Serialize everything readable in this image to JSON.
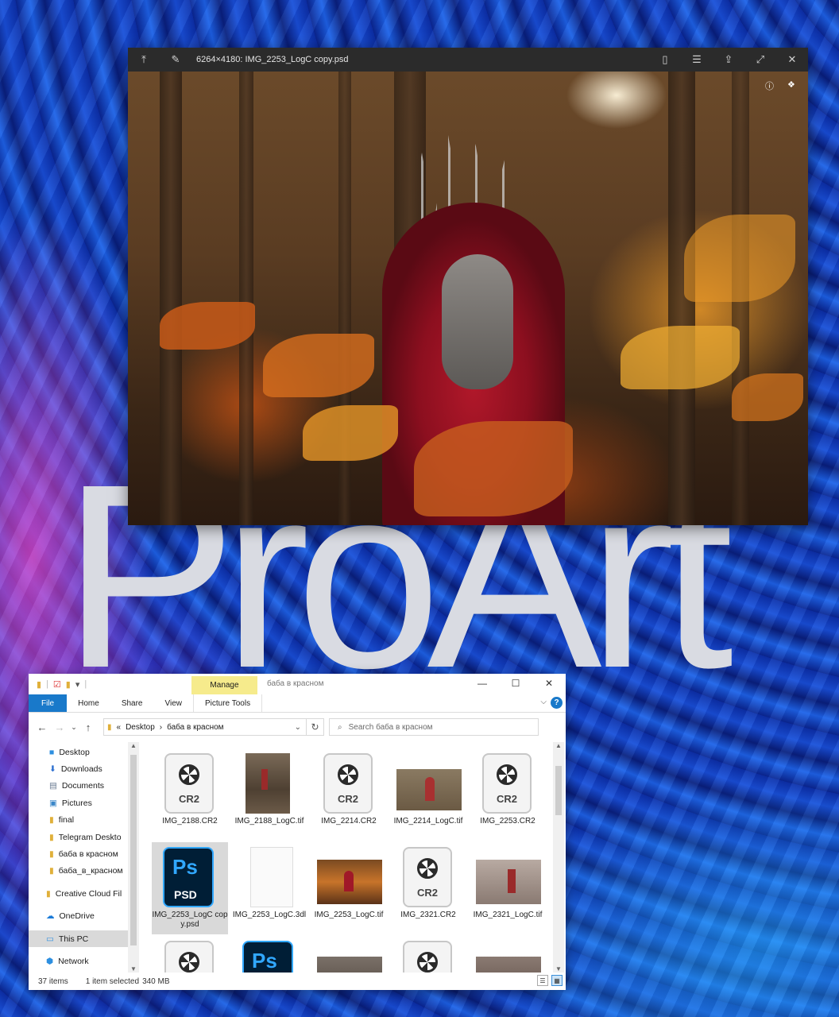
{
  "desktop": {
    "wallpaper_text": "ProArt"
  },
  "viewer": {
    "title": "6264×4180: IMG_2253_LogC copy.psd",
    "icons": [
      "pin-top-icon",
      "pin-icon",
      "file-icon",
      "list-icon",
      "share-icon",
      "fullscreen-icon",
      "close-icon",
      "info-icon",
      "color-icon"
    ]
  },
  "explorer": {
    "title": "баба в красном",
    "manage_tab": "Manage",
    "ribbon_tabs": [
      "File",
      "Home",
      "Share",
      "View",
      "Picture Tools"
    ],
    "breadcrumb": {
      "root": "«",
      "part1": "Desktop",
      "part2": "баба в красном"
    },
    "search_placeholder": "Search баба в красном",
    "nav_items": [
      {
        "label": "Desktop",
        "icon": "desktop-icon",
        "pinned": true
      },
      {
        "label": "Downloads",
        "icon": "download-icon",
        "pinned": true
      },
      {
        "label": "Documents",
        "icon": "documents-icon",
        "pinned": true
      },
      {
        "label": "Pictures",
        "icon": "pictures-icon",
        "pinned": true
      },
      {
        "label": "final",
        "icon": "folder-icon",
        "pinned": false
      },
      {
        "label": "Telegram Deskto",
        "icon": "folder-icon",
        "pinned": false
      },
      {
        "label": "баба в красном",
        "icon": "folder-icon",
        "pinned": false
      },
      {
        "label": "баба_в_красном",
        "icon": "folder-icon",
        "pinned": false
      },
      {
        "label": "Creative Cloud Fil",
        "icon": "creative-cloud-icon",
        "pinned": false
      },
      {
        "label": "OneDrive",
        "icon": "onedrive-icon",
        "pinned": false
      },
      {
        "label": "This PC",
        "icon": "pc-icon",
        "pinned": false
      },
      {
        "label": "Network",
        "icon": "network-icon",
        "pinned": false
      }
    ],
    "files": [
      {
        "name": "IMG_2188.CR2",
        "kind": "cr2",
        "tag": "CR2"
      },
      {
        "name": "IMG_2188_LogC.tif",
        "kind": "photo-tall"
      },
      {
        "name": "IMG_2214.CR2",
        "kind": "cr2",
        "tag": "CR2"
      },
      {
        "name": "IMG_2214_LogC.tif",
        "kind": "photo"
      },
      {
        "name": "IMG_2253.CR2",
        "kind": "cr2",
        "tag": "CR2"
      },
      {
        "name": "IMG_2253_LogC copy.psd",
        "kind": "psd",
        "ps": "Ps",
        "ext": "PSD",
        "selected": true
      },
      {
        "name": "IMG_2253_LogC.3dl",
        "kind": "blank"
      },
      {
        "name": "IMG_2253_LogC.tif",
        "kind": "photo"
      },
      {
        "name": "IMG_2321.CR2",
        "kind": "cr2",
        "tag": "CR2"
      },
      {
        "name": "IMG_2321_LogC.tif",
        "kind": "photo"
      }
    ],
    "status": {
      "items": "37 items",
      "selected": "1 item selected",
      "size": "340 MB"
    }
  }
}
